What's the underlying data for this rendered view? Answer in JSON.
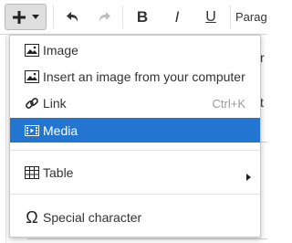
{
  "toolbar": {
    "insert_icon": "plus-icon",
    "undo_icon": "undo-icon",
    "redo_icon": "redo-icon",
    "bold_label": "B",
    "italic_label": "I",
    "underline_label": "U",
    "format_label": "Parag"
  },
  "editor": {
    "peek_text_1": "r",
    "peek_text_2": "t"
  },
  "menu": {
    "items": [
      {
        "label": "Image",
        "icon": "image-icon"
      },
      {
        "label": "Insert an image from your computer",
        "icon": "image-icon"
      },
      {
        "label": "Link",
        "icon": "link-icon",
        "shortcut": "Ctrl+K"
      },
      {
        "label": "Media",
        "icon": "media-icon",
        "active": true
      },
      {
        "label": "Table",
        "icon": "table-icon",
        "submenu": true
      },
      {
        "label": "Special character",
        "icon": "omega-icon"
      }
    ]
  },
  "colors": {
    "active_bg": "#2276d2",
    "active_text": "#ffffff",
    "shortcut_text": "#9a9a9a",
    "insert_button_bg": "#dedede"
  }
}
